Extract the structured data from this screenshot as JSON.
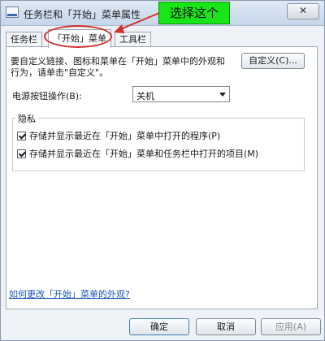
{
  "window": {
    "title": "任务栏和「开始」菜单属性",
    "close_label": "✕"
  },
  "annotation": {
    "text": "选择这个",
    "color": "#19e619"
  },
  "tabs": [
    {
      "label": "任务栏"
    },
    {
      "label": "「开始」菜单"
    },
    {
      "label": "工具栏"
    }
  ],
  "start_menu": {
    "description": "要自定义链接、图标和菜单在「开始」菜单中的外观和行为，请单击\"自定义\"。",
    "customize_label": "自定义(C)...",
    "power_button_label": "电源按钮操作(B):",
    "power_button_value": "关机",
    "privacy": {
      "legend": "隐私",
      "options": [
        {
          "label": "存储并显示最近在「开始」菜单中打开的程序(P)",
          "checked": true
        },
        {
          "label": "存储并显示最近在「开始」菜单和任务栏中打开的项目(M)",
          "checked": true
        }
      ]
    },
    "help_link": "如何更改「开始」菜单的外观?"
  },
  "footer": {
    "ok_label": "确定",
    "cancel_label": "取消",
    "apply_label": "应用(A)"
  }
}
